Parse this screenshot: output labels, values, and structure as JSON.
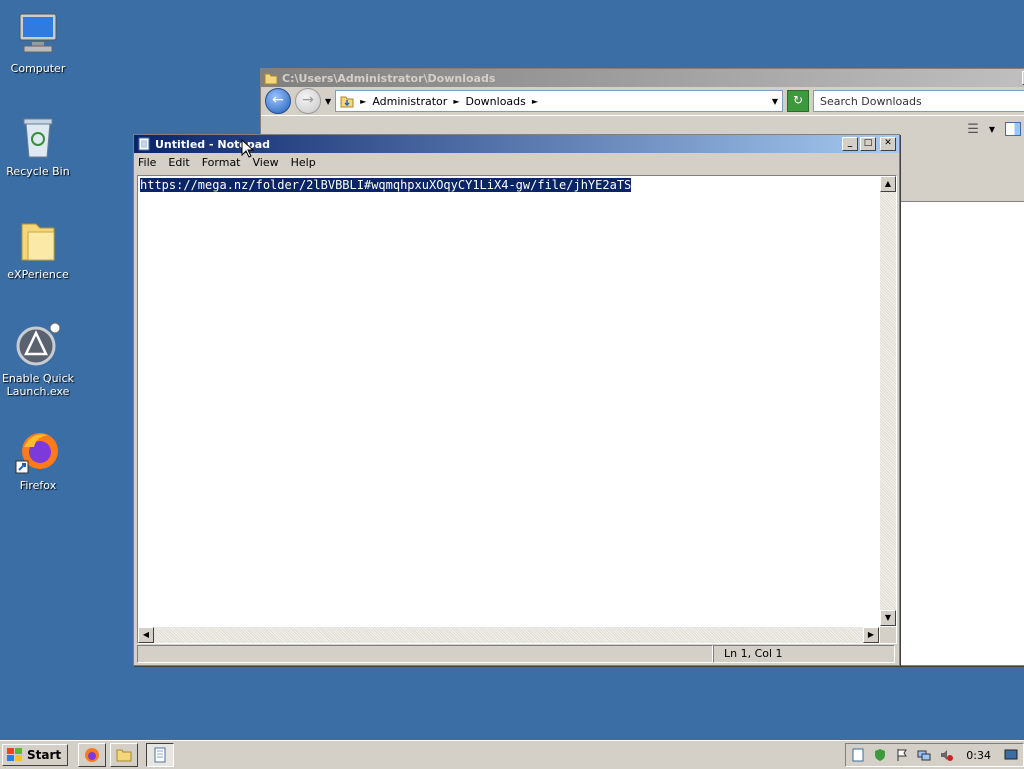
{
  "desktop": {
    "icons": [
      {
        "label": "Computer"
      },
      {
        "label": "Recycle Bin"
      },
      {
        "label": "eXPerience"
      },
      {
        "label": "Enable Quick Launch.exe"
      },
      {
        "label": "Firefox"
      }
    ]
  },
  "explorer": {
    "title": "C:\\Users\\Administrator\\Downloads",
    "breadcrumb": [
      "Administrator",
      "Downloads"
    ],
    "search_placeholder": "Search Downloads"
  },
  "notepad": {
    "title": "Untitled - Notepad",
    "menu": [
      "File",
      "Edit",
      "Format",
      "View",
      "Help"
    ],
    "content": "https://mega.nz/folder/2lBVBBLI#wqmqhpxuXOqyCY1LiX4-gw/file/jhYE2aTS",
    "status": "Ln 1, Col 1"
  },
  "taskbar": {
    "start_label": "Start",
    "clock": "0:34"
  },
  "colors": {
    "desktop": "#3a6ea5",
    "titlebar_active": "#0a246a",
    "selection": "#0a246a"
  }
}
